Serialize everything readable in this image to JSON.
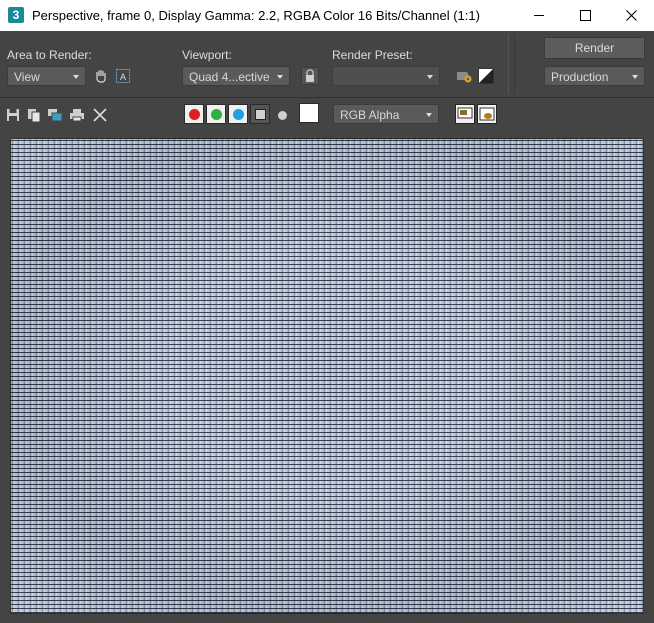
{
  "window": {
    "app_icon": "3",
    "title": "Perspective, frame 0, Display Gamma: 2.2, RGBA Color 16 Bits/Channel (1:1)"
  },
  "controls": {
    "area_to_render_label": "Area to Render:",
    "area_to_render_value": "View",
    "viewport_label": "Viewport:",
    "viewport_value": "Quad 4...ective",
    "render_preset_label": "Render Preset:",
    "render_preset_value": "",
    "render_button": "Render",
    "render_mode_value": "Production"
  },
  "toolbar": {
    "channel_display_value": "RGB Alpha",
    "channels": {
      "red_color": "#e02020",
      "green_color": "#30b040",
      "blue_color": "#20a0e0"
    },
    "swatch_color": "#ffffff"
  },
  "icons": {
    "save": "save-icon",
    "copy": "copy-icon",
    "clone": "clone-window-icon",
    "print": "print-icon",
    "clear": "close-icon"
  }
}
